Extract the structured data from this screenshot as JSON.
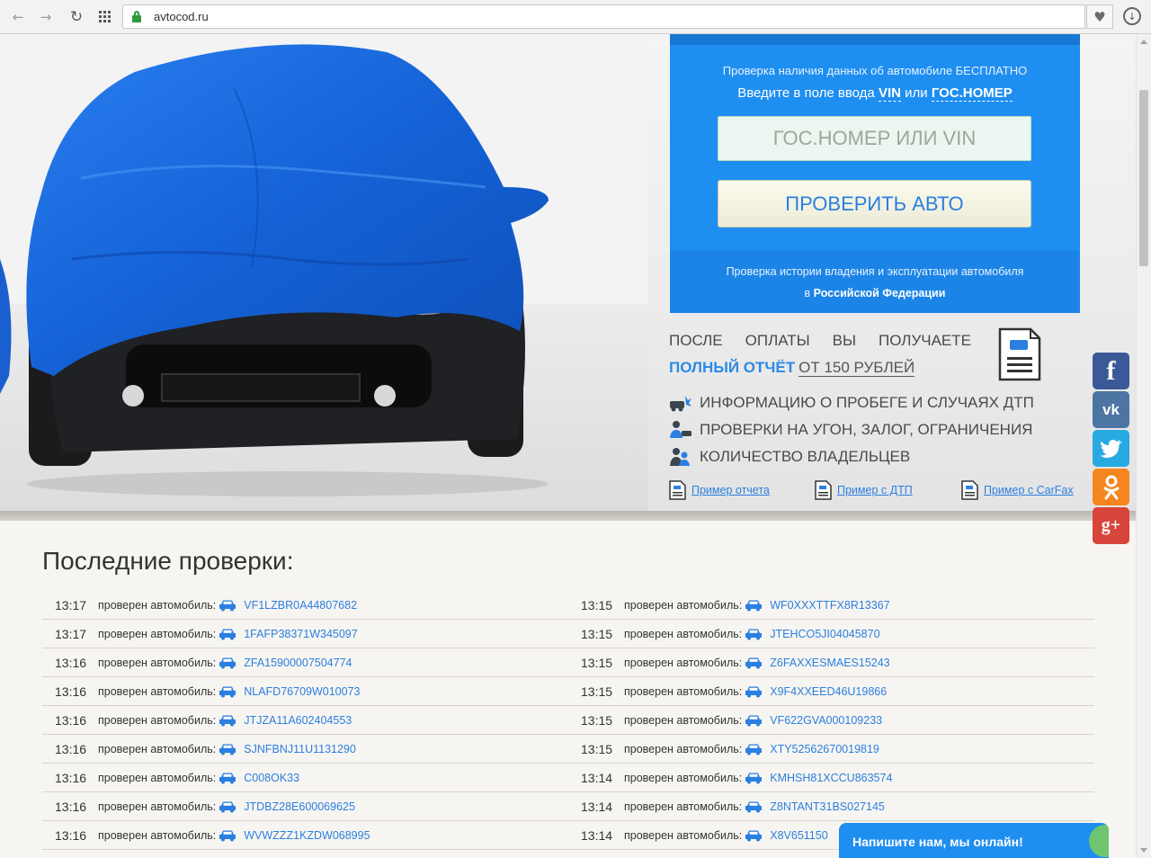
{
  "browser": {
    "url": "avtocod.ru"
  },
  "check_panel": {
    "line1": "Проверка наличия данных об автомобиле БЕСПЛАТНО",
    "line2_prefix": "Введите в поле ввода",
    "line2_vin": "VIN",
    "line2_or": "или",
    "line2_plate": "ГОС.НОМЕР",
    "input_placeholder": "ГОС.НОМЕР ИЛИ VIN",
    "button_label": "ПРОВЕРИТЬ АВТО",
    "footer_line1": "Проверка истории владения и эксплуатации автомобиля",
    "footer_line2_prefix": "в",
    "footer_line2_bold": "Российской Федерации"
  },
  "after_payment": {
    "words": [
      "ПОСЛЕ",
      "ОПЛАТЫ",
      "ВЫ",
      "ПОЛУЧАЕТЕ"
    ],
    "full_report": "ПОЛНЫЙ ОТЧЁТ",
    "price": "ОТ 150 РУБЛЕЙ",
    "features": [
      {
        "icon": "crash-car-icon",
        "text": "ИНФОРМАЦИЮ О ПРОБЕГЕ И СЛУЧАЯХ ДТП"
      },
      {
        "icon": "police-check-icon",
        "text": "ПРОВЕРКИ НА УГОН, ЗАЛОГ, ОГРАНИЧЕНИЯ"
      },
      {
        "icon": "owners-icon",
        "text": "КОЛИЧЕСТВО ВЛАДЕЛЬЦЕВ"
      }
    ],
    "examples": [
      "Пример отчета",
      "Пример с ДТП",
      "Пример с CarFax"
    ]
  },
  "social": {
    "facebook": "f",
    "vk": "vk",
    "google_plus": "g+"
  },
  "recent": {
    "title": "Последние проверки:",
    "checked_label": "проверен автомобиль:",
    "rows": [
      {
        "left": {
          "time": "13:17",
          "vin": "VF1LZBR0A44807682"
        },
        "right": {
          "time": "13:15",
          "vin": "WF0XXXTTFX8R13367"
        }
      },
      {
        "left": {
          "time": "13:17",
          "vin": "1FAFP38371W345097"
        },
        "right": {
          "time": "13:15",
          "vin": "JTEHCO5JI04045870"
        }
      },
      {
        "left": {
          "time": "13:16",
          "vin": "ZFA15900007504774"
        },
        "right": {
          "time": "13:15",
          "vin": "Z6FAXXESMAES15243"
        }
      },
      {
        "left": {
          "time": "13:16",
          "vin": "NLAFD76709W010073"
        },
        "right": {
          "time": "13:15",
          "vin": "X9F4XXEED46U19866"
        }
      },
      {
        "left": {
          "time": "13:16",
          "vin": "JTJZA11A602404553"
        },
        "right": {
          "time": "13:15",
          "vin": "VF622GVA000109233"
        }
      },
      {
        "left": {
          "time": "13:16",
          "vin": "SJNFBNJ11U1131290"
        },
        "right": {
          "time": "13:15",
          "vin": "XTY52562670019819"
        }
      },
      {
        "left": {
          "time": "13:16",
          "vin": "C008OK33"
        },
        "right": {
          "time": "13:14",
          "vin": "KMHSH81XCCU863574"
        }
      },
      {
        "left": {
          "time": "13:16",
          "vin": "JTDBZ28E600069625"
        },
        "right": {
          "time": "13:14",
          "vin": "Z8NTANT31BS027145"
        }
      },
      {
        "left": {
          "time": "13:16",
          "vin": "WVWZZZ1KZDW068995"
        },
        "right": {
          "time": "13:14",
          "vin": "X8V651150"
        }
      }
    ]
  },
  "chat": {
    "text": "Напишите нам, мы онлайн!"
  },
  "colors": {
    "brand_blue": "#1e8ef0",
    "link_blue": "#2b7fe0",
    "car_cover": "#1565d8"
  }
}
